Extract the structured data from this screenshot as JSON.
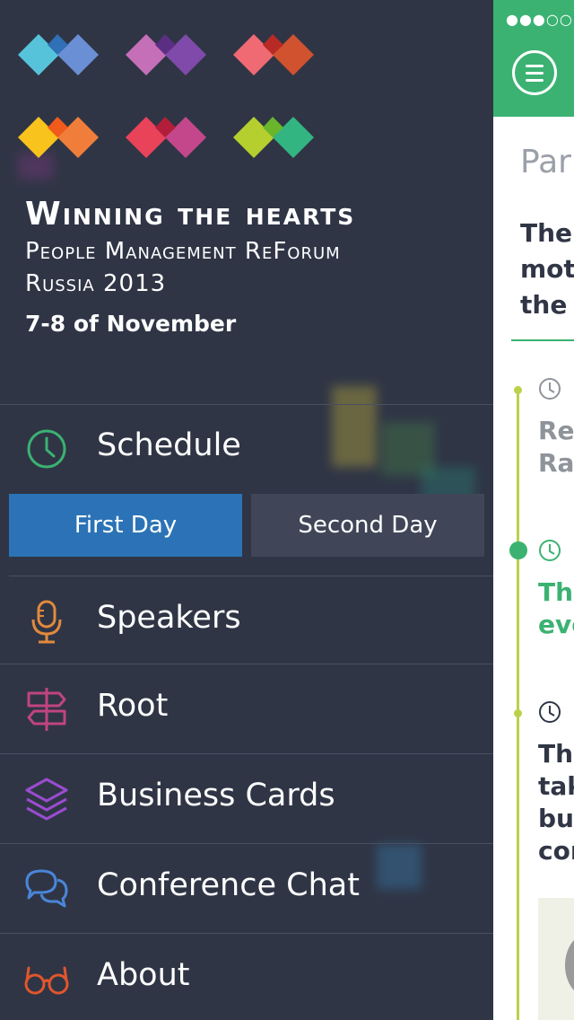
{
  "header": {
    "title": "Winning the hearts",
    "subtitle_line1": "People Management ReForum",
    "subtitle_line2": "Russia 2013",
    "dates": "7-8 of November"
  },
  "menu": {
    "schedule": {
      "label": "Schedule",
      "icon": "clock-icon",
      "color": "#3bb272"
    },
    "tabs": [
      {
        "label": "First Day",
        "active": true,
        "color": "#2b73b6"
      },
      {
        "label": "Second Day",
        "active": false,
        "color": "#404658"
      }
    ],
    "items": [
      {
        "label": "Speakers",
        "icon": "microphone-icon",
        "color": "#e28a3d"
      },
      {
        "label": "Root",
        "icon": "signpost-icon",
        "color": "#c0457f"
      },
      {
        "label": "Business Cards",
        "icon": "layers-icon",
        "color": "#9a4cd0"
      },
      {
        "label": "Conference Chat",
        "icon": "chat-bubbles-icon",
        "color": "#4a86d8"
      },
      {
        "label": "About",
        "icon": "glasses-icon",
        "color": "#e0562d"
      }
    ]
  },
  "content": {
    "status_dots": "●●●○○",
    "page_title_partial": "Par",
    "heading_partial": "The\nmot\nthe",
    "entries": [
      {
        "text": "Re\nRa",
        "color": "#8f949b"
      },
      {
        "text": "The\neve",
        "color": "#3bb272"
      },
      {
        "text": "The\ntak\nbu\ncor",
        "color": "#303645"
      }
    ]
  },
  "colors": {
    "drawer_bg": "#2f3545",
    "accent_green": "#3bb272",
    "timeline_lime": "#b9d24a"
  }
}
